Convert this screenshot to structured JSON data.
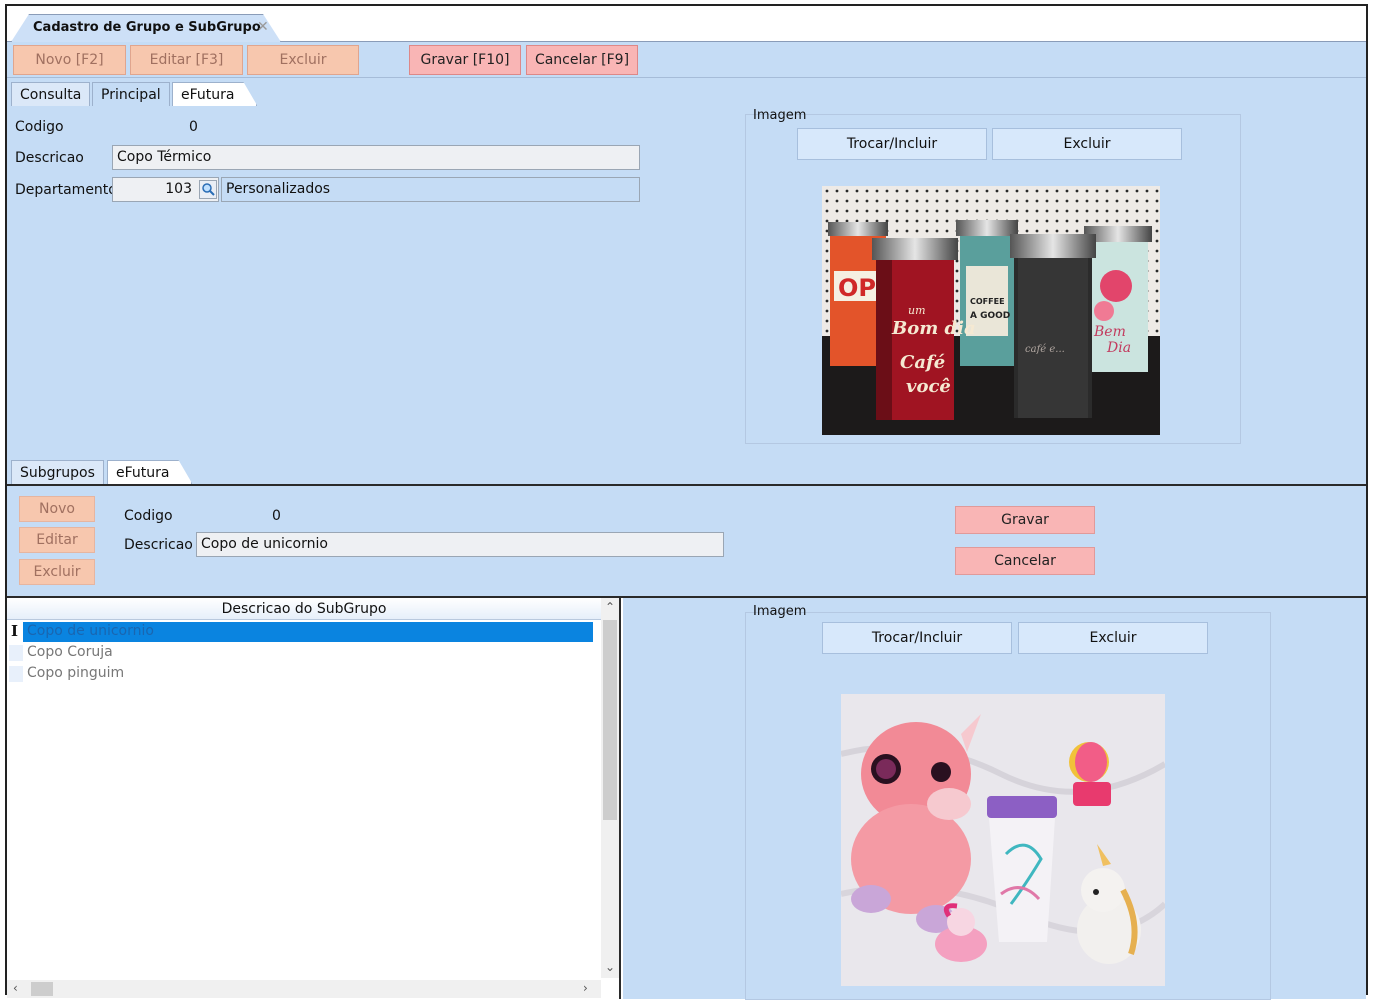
{
  "window": {
    "tab_title": "Cadastro de Grupo e SubGrupo",
    "tab_close": "✕"
  },
  "toolbar": {
    "novo": "Novo [F2]",
    "editar": "Editar [F3]",
    "excluir": "Excluir",
    "gravar": "Gravar [F10]",
    "cancelar": "Cancelar [F9]"
  },
  "main_tabs": {
    "consulta": "Consulta",
    "principal": "Principal",
    "efutura": "eFutura"
  },
  "group_form": {
    "codigo_label": "Codigo",
    "codigo_value": "0",
    "descricao_label": "Descricao",
    "descricao_value": "Copo Térmico",
    "departamento_label": "Departamento",
    "departamento_code": "103",
    "departamento_name": "Personalizados"
  },
  "group_image": {
    "title": "Imagem",
    "trocar": "Trocar/Incluir",
    "excluir": "Excluir",
    "photo_text": {
      "cup_line1": "um",
      "cup_line2": "Bom dia",
      "cup_line3": "Café",
      "cup_line4": "você",
      "coffee": "COFFEE",
      "good": "A GOOD",
      "bem": "Bem",
      "dia": "Dia",
      "cafe_e": "café e..."
    }
  },
  "sub_tabs": {
    "subgrupos": "Subgrupos",
    "efutura": "eFutura"
  },
  "subgroup_form": {
    "novo": "Novo",
    "editar": "Editar",
    "excluir": "Excluir",
    "codigo_label": "Codigo",
    "codigo_value": "0",
    "descricao_label": "Descricao",
    "descricao_value": "Copo de unicornio",
    "gravar": "Gravar",
    "cancelar": "Cancelar"
  },
  "subgroup_grid": {
    "header": "Descricao do SubGrupo",
    "rows": [
      "Copo de unicornio",
      "Copo Coruja",
      "Copo pinguim"
    ]
  },
  "subgroup_image": {
    "title": "Imagem",
    "trocar": "Trocar/Incluir",
    "excluir": "Excluir"
  },
  "colors": {
    "panel": "#c5dcf5",
    "disabled_button": "#f7c7ae",
    "active_button": "#f9b5b5",
    "selection": "#0a84e0"
  }
}
